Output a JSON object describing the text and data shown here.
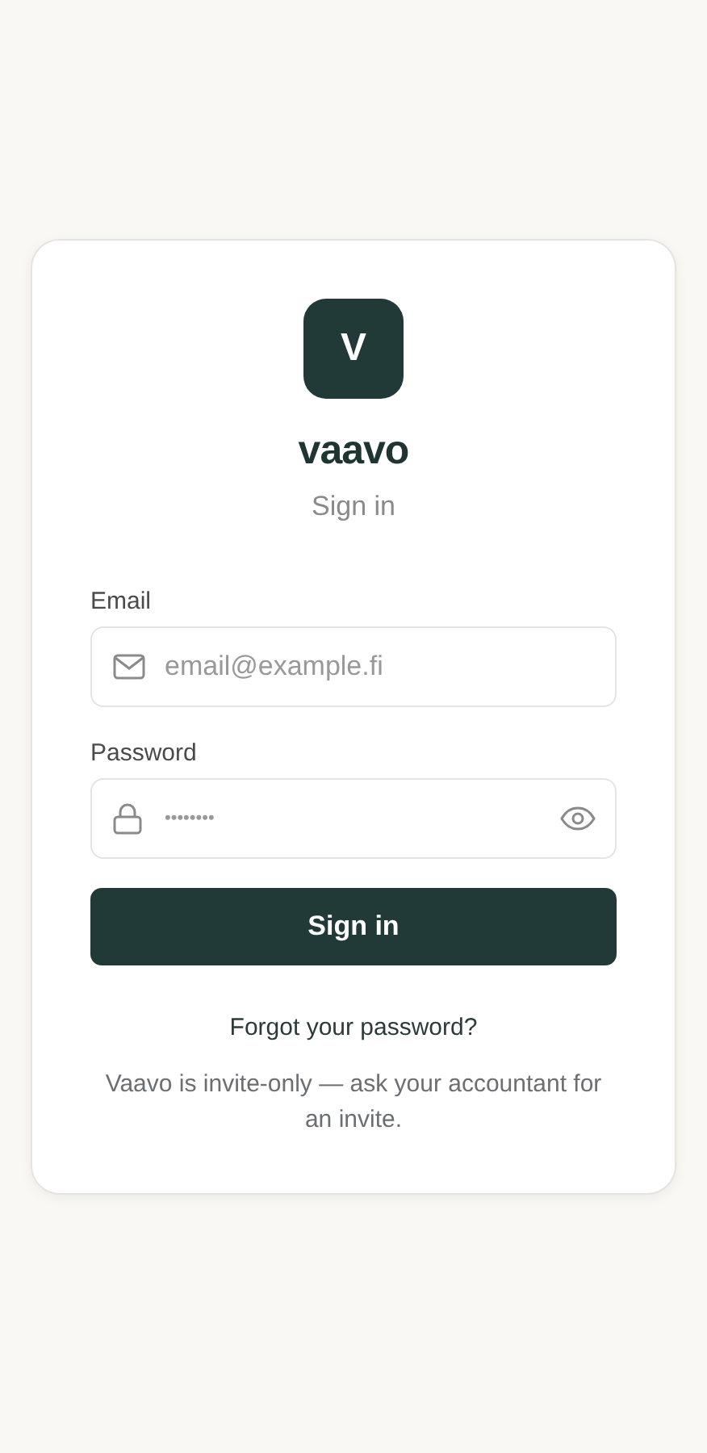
{
  "logo": {
    "letter": "V"
  },
  "brand": "vaavo",
  "subtitle": "Sign in",
  "fields": [
    {
      "kind": "email",
      "label": "Email",
      "placeholder": "email@example.fi"
    },
    {
      "kind": "password",
      "label": "Password",
      "placeholder": "••••••••"
    }
  ],
  "submit": "Sign in",
  "forgot_link": "Forgot your password?",
  "note": "Vaavo is invite-only — ask your accountant for an invite."
}
